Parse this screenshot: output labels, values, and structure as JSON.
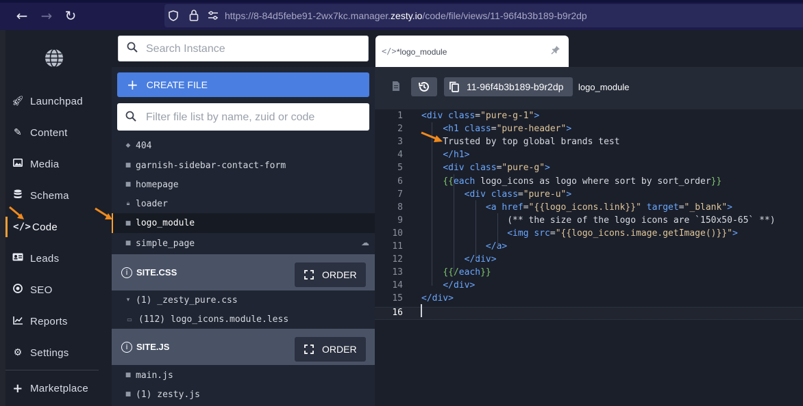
{
  "browser": {
    "url_prefix": "https://8-84d5febe91-2wx7kc.manager.",
    "url_domain": "zesty.io",
    "url_path": "/code/file/views/11-96f4b3b189-b9r2dp"
  },
  "sidebar": {
    "items": [
      {
        "label": "Launchpad",
        "icon": "rocket-icon"
      },
      {
        "label": "Content",
        "icon": "edit-icon"
      },
      {
        "label": "Media",
        "icon": "image-icon"
      },
      {
        "label": "Schema",
        "icon": "database-icon"
      },
      {
        "label": "Code",
        "icon": "code-icon"
      },
      {
        "label": "Leads",
        "icon": "id-card-icon"
      },
      {
        "label": "SEO",
        "icon": "target-icon"
      },
      {
        "label": "Reports",
        "icon": "chart-icon"
      },
      {
        "label": "Settings",
        "icon": "gear-icon"
      },
      {
        "label": "Marketplace",
        "icon": "plus-icon"
      }
    ]
  },
  "search": {
    "placeholder": "Search Instance"
  },
  "files": {
    "create_label": "CREATE FILE",
    "filter_placeholder": "Filter file list by name, zuid or code",
    "views": [
      {
        "name": "404"
      },
      {
        "name": "garnish-sidebar-contact-form"
      },
      {
        "name": "homepage"
      },
      {
        "name": "loader"
      },
      {
        "name": "logo_module"
      },
      {
        "name": "simple_page"
      }
    ],
    "css_title": "SITE.CSS",
    "css_files": [
      {
        "name": "(1) _zesty_pure.css"
      },
      {
        "name": "(112) logo_icons.module.less"
      }
    ],
    "js_title": "SITE.JS",
    "js_files": [
      {
        "name": "main.js"
      },
      {
        "name": "(1) zesty.js"
      }
    ],
    "order_label": "ORDER"
  },
  "editor": {
    "tab_label": "*logo_module",
    "zuid": "11-96f4b3b189-b9r2dp",
    "file_name": "logo_module",
    "line_numbers": [
      "1",
      "2",
      "3",
      "4",
      "5",
      "6",
      "7",
      "8",
      "9",
      "10",
      "11",
      "12",
      "13",
      "14",
      "15",
      "16"
    ],
    "code": [
      "<div class=\"pure-g-1\">",
      "    <h1 class=\"pure-header\">",
      "    Trusted by top global brands test",
      "    </h1>",
      "    <div class=\"pure-g\">",
      "    {{each logo_icons as logo where sort by sort_order}}",
      "        <div class=\"pure-u\">",
      "            <a href=\"{{logo_icons.link}}\" target=\"_blank\">",
      "                (** the size of the logo icons are `150x50-65` **)",
      "                <img src=\"{{logo_icons.image.getImage()}}\">",
      "            </a>",
      "        </div>",
      "    {{/each}}",
      "    </div>",
      "</div>",
      ""
    ]
  },
  "colors": {
    "accent": "#f59f34",
    "primary_button": "#4a7ee0",
    "sidebar_bg": "#1b1f2a"
  }
}
